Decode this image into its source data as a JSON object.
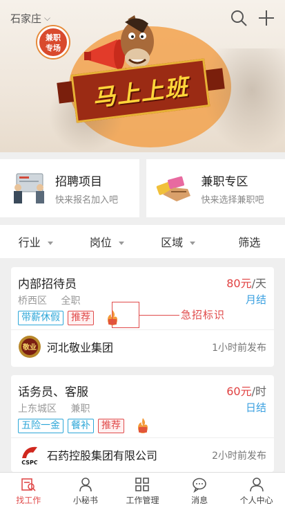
{
  "banner": {
    "city": "石家庄",
    "badge_line1": "兼职",
    "badge_line2": "专场",
    "slogan": "马上上班"
  },
  "shortcuts": [
    {
      "title": "招聘项目",
      "subtitle": "快来报名加入吧"
    },
    {
      "title": "兼职专区",
      "subtitle": "快来选择兼职吧"
    }
  ],
  "filters": [
    "行业",
    "岗位",
    "区域",
    "筛选"
  ],
  "jobs": [
    {
      "title": "内部招待员",
      "pay_num": "80元",
      "pay_unit": "/天",
      "district": "桥西区",
      "type": "全职",
      "settle": "月结",
      "tags": [
        "带薪休假",
        "推荐"
      ],
      "company": "河北敬业集团",
      "logo_text": "敬业",
      "time": "1小时前发布"
    },
    {
      "title": "话务员、客服",
      "pay_num": "60元",
      "pay_unit": "/时",
      "district": "上东城区",
      "type": "兼职",
      "settle": "日结",
      "tags": [
        "五险一金",
        "餐补",
        "推荐"
      ],
      "company": "石药控股集团有限公司",
      "logo_text": "CSPC",
      "time": "2小时前发布"
    }
  ],
  "annotation": "急招标识",
  "nav": [
    "找工作",
    "小秘书",
    "工作管理",
    "消息",
    "个人中心"
  ],
  "colors": {
    "accent": "#e04a4a",
    "blue": "#2ba6d8",
    "slogan_bg": "#9b2b14",
    "slogan_text": "#ffd53a"
  }
}
